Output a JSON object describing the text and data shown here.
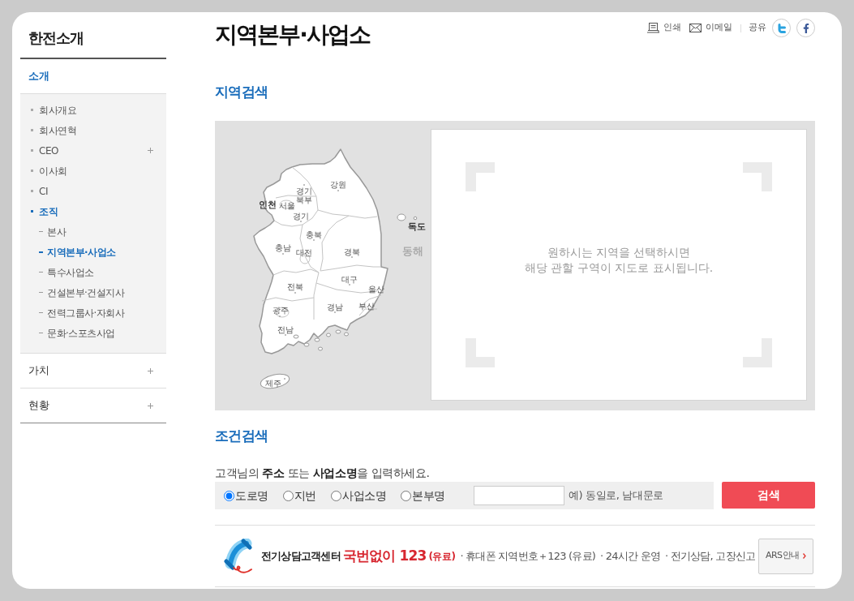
{
  "sidebar": {
    "title": "한전소개",
    "sections": [
      {
        "label": "소개",
        "selected": true,
        "expandable": false,
        "items": [
          {
            "label": "회사개요",
            "selected": false,
            "expandable": false
          },
          {
            "label": "회사연혁",
            "selected": false,
            "expandable": false
          },
          {
            "label": "CEO",
            "selected": false,
            "expandable": true
          },
          {
            "label": "이사회",
            "selected": false,
            "expandable": false
          },
          {
            "label": "CI",
            "selected": false,
            "expandable": false
          },
          {
            "label": "조직",
            "selected": true,
            "expandable": false,
            "children": [
              {
                "label": "본사",
                "selected": false
              },
              {
                "label": "지역본부·사업소",
                "selected": true
              },
              {
                "label": "특수사업소",
                "selected": false
              },
              {
                "label": "건설본부·건설지사",
                "selected": false
              },
              {
                "label": "전력그룹사·자회사",
                "selected": false
              },
              {
                "label": "문화·스포츠사업",
                "selected": false
              }
            ]
          }
        ]
      },
      {
        "label": "가치",
        "selected": false,
        "expandable": true
      },
      {
        "label": "현황",
        "selected": false,
        "expandable": true
      }
    ]
  },
  "header": {
    "title": "지역본부·사업소",
    "tools": [
      {
        "kind": "print",
        "label": "인쇄"
      },
      {
        "kind": "email",
        "label": "이메일"
      }
    ],
    "share": {
      "label": "공유",
      "services": [
        {
          "kind": "twitter"
        },
        {
          "kind": "facebook"
        }
      ]
    }
  },
  "region_search": {
    "heading": "지역검색",
    "map": {
      "labels": [
        {
          "label": "강원",
          "kind": "plain"
        },
        {
          "label": "경기 북부",
          "kind": "plain"
        },
        {
          "label": "인천",
          "kind": "bold"
        },
        {
          "label": "서울",
          "kind": "plain"
        },
        {
          "label": "경기",
          "kind": "plain"
        },
        {
          "label": "충북",
          "kind": "plain"
        },
        {
          "label": "충남",
          "kind": "plain"
        },
        {
          "label": "대전",
          "kind": "plain"
        },
        {
          "label": "경북",
          "kind": "plain"
        },
        {
          "label": "대구",
          "kind": "plain"
        },
        {
          "label": "울산",
          "kind": "plain"
        },
        {
          "label": "전북",
          "kind": "plain"
        },
        {
          "label": "경남",
          "kind": "plain"
        },
        {
          "label": "부산",
          "kind": "plain"
        },
        {
          "label": "광주",
          "kind": "plain"
        },
        {
          "label": "전남",
          "kind": "plain"
        },
        {
          "label": "제주",
          "kind": "plain"
        },
        {
          "label": "독도",
          "kind": "bold"
        },
        {
          "label": "동해",
          "kind": "sea"
        }
      ]
    },
    "result": {
      "message": [
        "원하시는 지역을 선택하시면",
        "해당 관할 구역이 지도로 표시됩니다."
      ]
    }
  },
  "condition_search": {
    "heading": "조건검색",
    "instruction": "고객님의 **주소** 또는 **사업소명**을 입력하세요.",
    "search_types": [
      {
        "label": "도로명",
        "selected": true
      },
      {
        "label": "지번",
        "selected": false
      },
      {
        "label": "사업소명",
        "selected": false
      },
      {
        "label": "본부명",
        "selected": false
      }
    ],
    "example": "예) 동일로, 남대문로",
    "button": "검색"
  },
  "customer_center": {
    "name": "전기상담고객센터",
    "number": "국번없이 123",
    "number_note": "(유료)",
    "details": [
      "· 휴대폰 지역번호＋123 (유료)",
      "· 24시간 운영",
      "· 전기상담, 고장신고"
    ],
    "ars_button": "ARS안내"
  }
}
